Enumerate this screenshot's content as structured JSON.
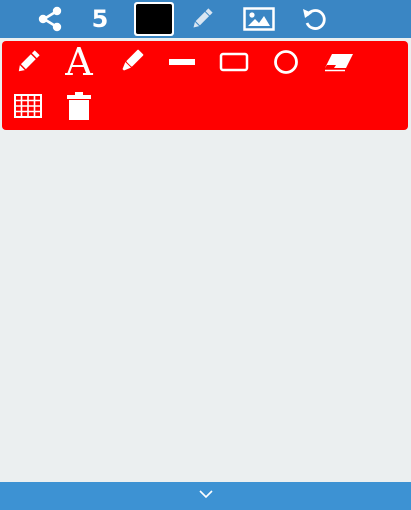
{
  "toolbar": {
    "stroke_width": "5",
    "current_color": "#000000",
    "icons": [
      "share-icon",
      "color-swatch",
      "pencil-icon",
      "image-icon",
      "undo-icon"
    ]
  },
  "palette": {
    "background": "#ff0000",
    "text_tool_label": "A",
    "tools": [
      "pencil-icon",
      "text-tool",
      "marker-icon",
      "line-icon",
      "rectangle-icon",
      "circle-icon",
      "eraser-icon",
      "grid-icon",
      "trash-icon"
    ]
  },
  "colors": {
    "topbar": "#3a86c4",
    "bottombar": "#3d92d3",
    "canvas": "#ebeff0"
  }
}
